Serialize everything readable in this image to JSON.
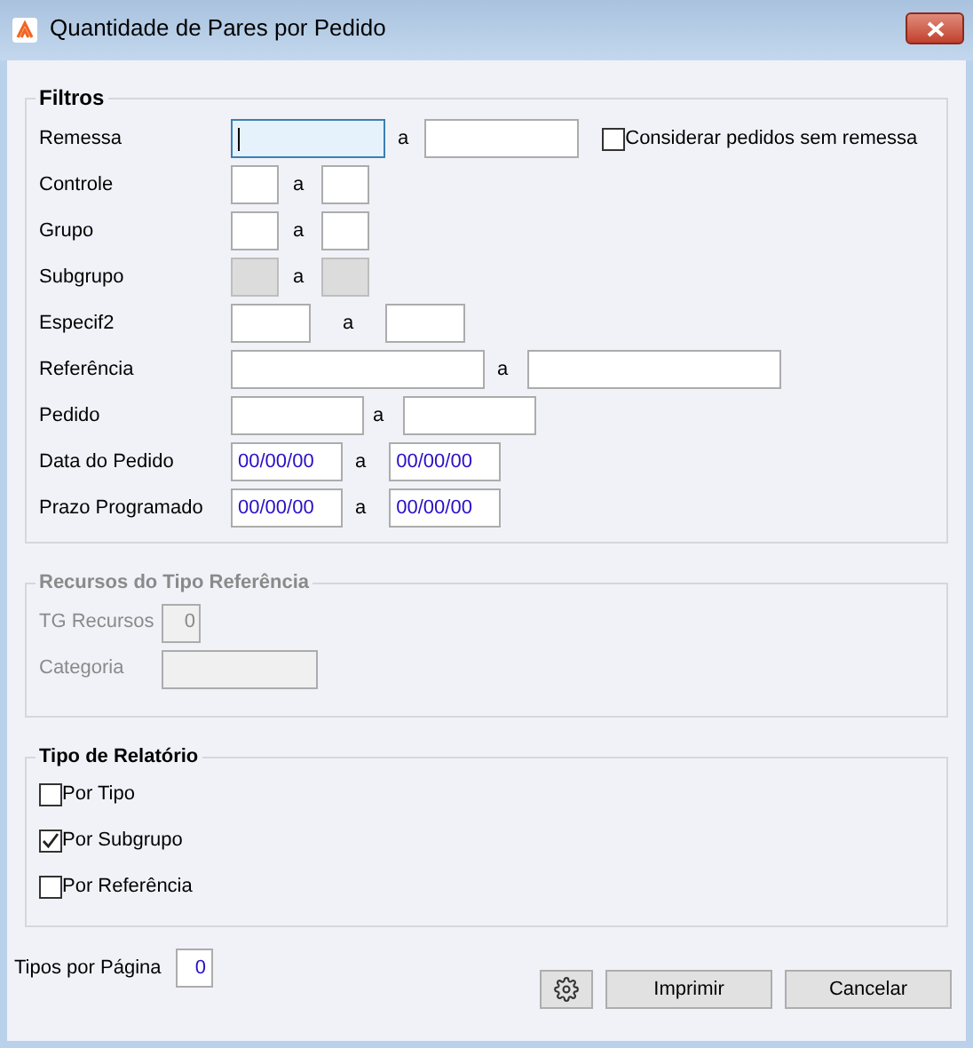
{
  "window": {
    "title": "Quantidade de Pares por Pedido"
  },
  "filters": {
    "title": "Filtros",
    "rows": [
      {
        "label": "Remessa",
        "disabled": false,
        "from": {
          "focused": true
        },
        "separator": "a",
        "to": {
          "focused": false
        },
        "checkbox": {
          "label": "Considerar pedidos sem remessa",
          "checked": false
        }
      },
      {
        "label": "Controle",
        "disabled": false,
        "from": {
          "focused": false
        },
        "separator": "a",
        "to": {
          "focused": false
        }
      },
      {
        "label": "Grupo",
        "disabled": false,
        "from": {
          "focused": false
        },
        "separator": "a",
        "to": {
          "focused": false
        }
      },
      {
        "label": "Subgrupo",
        "disabled": true,
        "from": {
          "focused": false
        },
        "separator": "a",
        "to": {
          "focused": false
        }
      },
      {
        "label": "Especif2",
        "disabled": false,
        "from": {
          "focused": false
        },
        "separator": "a",
        "to": {
          "focused": false
        }
      },
      {
        "label": "Referência",
        "disabled": false,
        "from": {
          "focused": false
        },
        "separator": "a",
        "to": {
          "focused": false
        }
      },
      {
        "label": "Pedido",
        "disabled": false,
        "from": {
          "focused": false
        },
        "separator": "a",
        "to": {
          "focused": false
        }
      },
      {
        "label": "Data do Pedido",
        "disabled": false,
        "from": {
          "value": "00/00/00",
          "focused": false
        },
        "separator": "a",
        "to": {
          "value": "00/00/00",
          "focused": false
        }
      },
      {
        "label": "Prazo Programado",
        "disabled": false,
        "from": {
          "value": "00/00/00",
          "focused": false
        },
        "separator": "a",
        "to": {
          "value": "00/00/00",
          "focused": false
        }
      }
    ]
  },
  "resources": {
    "title": "Recursos do Tipo Referência",
    "disabled": true,
    "tg_recursos": {
      "label": "TG Recursos",
      "value": "0"
    },
    "categoria": {
      "label": "Categoria"
    }
  },
  "report_type": {
    "title": "Tipo de Relatório",
    "options": [
      {
        "label": "Por Tipo",
        "checked": false
      },
      {
        "label": "Por Subgrupo",
        "checked": true
      },
      {
        "label": "Por Referência",
        "checked": false
      }
    ]
  },
  "types_per_page": {
    "label": "Tipos por Página",
    "value": "0"
  },
  "buttons": [
    {
      "kind": "settings"
    },
    {
      "kind": "text",
      "label": "Imprimir"
    },
    {
      "kind": "text",
      "label": "Cancelar"
    }
  ]
}
